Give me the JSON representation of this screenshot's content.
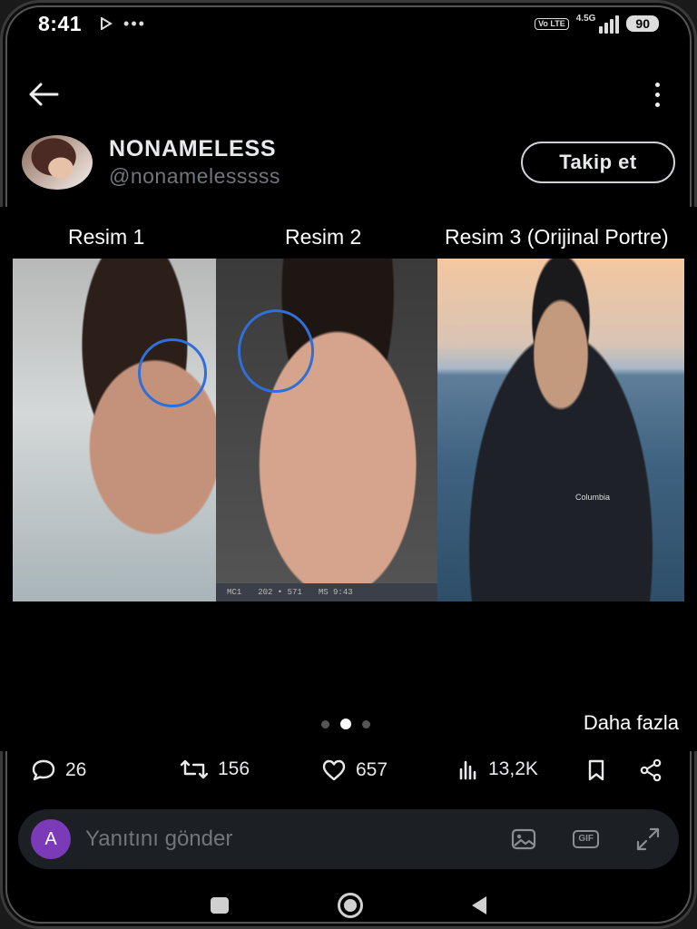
{
  "status_bar": {
    "time": "8:41",
    "volte": "Vo LTE",
    "network": "4.5G",
    "battery": "90"
  },
  "header": {
    "back_icon": "arrow-left-icon",
    "more_icon": "vertical-dots-icon"
  },
  "profile": {
    "display_name": "NONAMELESS",
    "handle": "@nonamelesssss",
    "follow_label": "Takip et"
  },
  "media": {
    "captions": [
      "Resim 1",
      "Resim 2",
      "Resim 3 (Orijinal Portre)"
    ],
    "photo2_bar": [
      "MC1",
      "202 • 571",
      "MS 9:43"
    ],
    "brand_tag": "Columbia",
    "carousel": {
      "total": 3,
      "active": 2
    },
    "more_label": "Daha fazla"
  },
  "actions": {
    "replies": "26",
    "reposts": "156",
    "likes": "657",
    "views": "13,2K"
  },
  "reply": {
    "avatar_letter": "A",
    "placeholder": "Yanıtını gönder",
    "gif_label": "GIF"
  },
  "colors": {
    "background": "#000000",
    "accent_circle": "#2f6fd6",
    "reply_avatar": "#7b3ab8",
    "muted_text": "#71767b"
  }
}
